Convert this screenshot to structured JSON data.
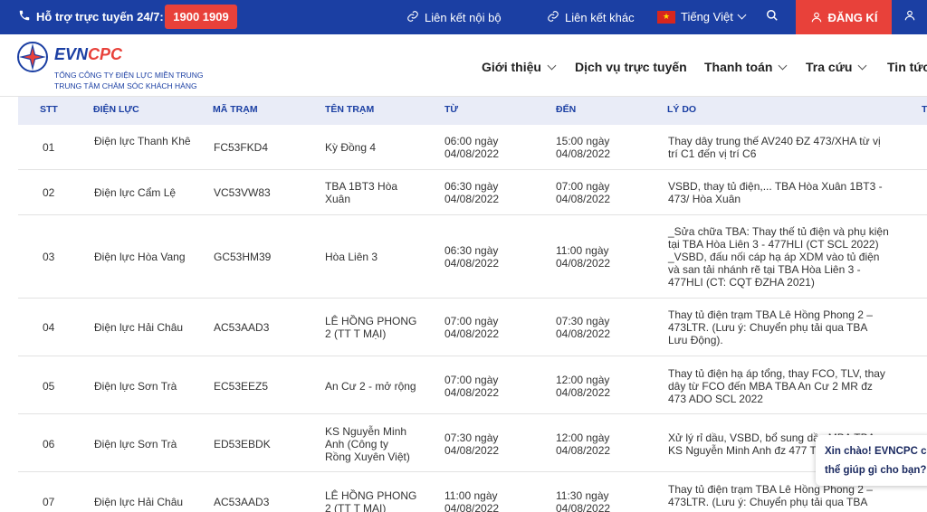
{
  "topbar": {
    "hotline_label": "Hỗ trợ trực tuyến 24/7:",
    "hotline_number": "1900 1909",
    "internal_link": "Liên kết nội bộ",
    "other_link": "Liên kết khác",
    "language": "Tiếng Việt",
    "register": "ĐĂNG KÍ"
  },
  "header": {
    "brand_evn": "EVN",
    "brand_cpc": "CPC",
    "brand_sub1": "TỔNG CÔNG TY ĐIỆN LỰC MIỀN TRUNG",
    "brand_sub2": "TRUNG TÂM CHĂM SÓC KHÁCH HÀNG",
    "nav": [
      "Giới thiệu",
      "Dịch vụ trực tuyến",
      "Thanh toán",
      "Tra cứu",
      "Tin tức"
    ]
  },
  "table": {
    "columns": [
      "STT",
      "ĐIỆN LỰC",
      "MÃ TRẠM",
      "TÊN TRẠM",
      "TỪ",
      "ĐẾN",
      "LÝ DO",
      "T"
    ],
    "rows": [
      {
        "stt": "01",
        "dienluc": "Điện lực Thanh Khê",
        "matram": "FC53FKD4",
        "tentram": "Kỳ Đồng 4",
        "tu": "06:00 ngày 04/08/2022",
        "den": "15:00 ngày 04/08/2022",
        "lydo": "Thay dây trung thế AV240 ĐZ 473/XHA từ vị trí C1 đến vị trí C6"
      },
      {
        "stt": "02",
        "dienluc": "Điện lực Cẩm Lệ",
        "matram": "VC53VW83",
        "tentram": "TBA 1BT3 Hòa Xuân",
        "tu": "06:30 ngày 04/08/2022",
        "den": "07:00 ngày 04/08/2022",
        "lydo": "VSBD, thay tủ điện,... TBA Hòa Xuân 1BT3 - 473/ Hòa Xuân"
      },
      {
        "stt": "03",
        "dienluc": "Điện lực Hòa Vang",
        "matram": "GC53HM39",
        "tentram": "Hòa Liên 3",
        "tu": "06:30 ngày 04/08/2022",
        "den": "11:00 ngày 04/08/2022",
        "lydo": "_Sửa chữa TBA: Thay thế tủ điện và phụ kiện tại TBA Hòa Liên 3 - 477HLI (CT SCL 2022) _VSBD, đấu nối cáp hạ áp XDM vào tủ điện và san tải nhánh rẽ tại TBA Hòa Liên 3 - 477HLI (CT: CQT ĐZHA 2021)"
      },
      {
        "stt": "04",
        "dienluc": "Điện lực Hải Châu",
        "matram": "AC53AAD3",
        "tentram": "LÊ HỒNG PHONG 2 (TT T MẠI)",
        "tu": "07:00 ngày 04/08/2022",
        "den": "07:30 ngày 04/08/2022",
        "lydo": "Thay tủ điện trạm TBA Lê Hồng Phong 2 – 473LTR. (Lưu ý: Chuyển phụ tải qua TBA Lưu Động)."
      },
      {
        "stt": "05",
        "dienluc": "Điện lực Sơn Trà",
        "matram": "EC53EEZ5",
        "tentram": "An Cư 2 - mở rộng",
        "tu": "07:00 ngày 04/08/2022",
        "den": "12:00 ngày 04/08/2022",
        "lydo": "Thay tủ điện hạ áp tổng, thay FCO, TLV, thay dây từ FCO đến MBA TBA An Cư 2 MR đz 473 ADO SCL 2022"
      },
      {
        "stt": "06",
        "dienluc": "Điện lực Sơn Trà",
        "matram": "ED53EBDK",
        "tentram": "KS Nguyễn Minh Anh (Công ty Rồng Xuyên Việt)",
        "tu": "07:30 ngày 04/08/2022",
        "den": "12:00 ngày 04/08/2022",
        "lydo": "Xử lý rỉ dầu, VSBD, bổ sung dầu MBA TBA KS Nguyễn Minh Anh đz 477 THO"
      },
      {
        "stt": "07",
        "dienluc": "Điện lực Hải Châu",
        "matram": "AC53AAD3",
        "tentram": "LÊ HỒNG PHONG 2 (TT T MẠI)",
        "tu": "11:00 ngày 04/08/2022",
        "den": "11:30 ngày 04/08/2022",
        "lydo": "Thay tủ điện trạm TBA Lê Hồng Phong 2 – 473LTR. (Lưu ý: Chuyển phụ tải qua TBA"
      }
    ]
  },
  "chat": {
    "line1": "Xin chào! EVNCPC có",
    "line2": "thể giúp gì cho bạn?"
  }
}
